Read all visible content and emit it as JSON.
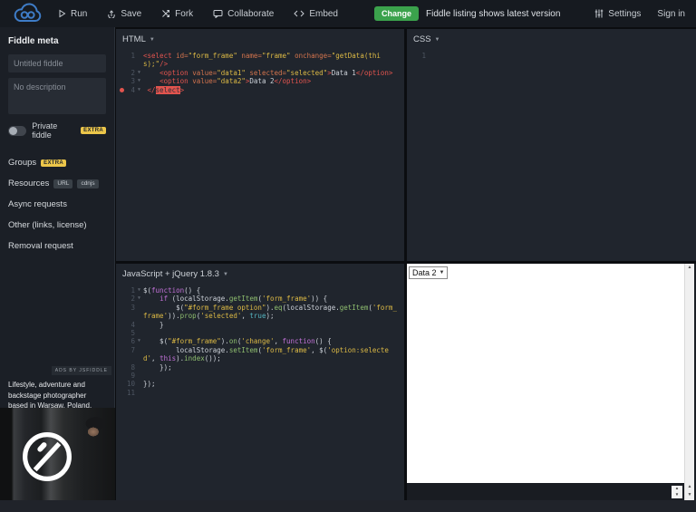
{
  "header": {
    "buttons": [
      {
        "label": "Run"
      },
      {
        "label": "Save"
      },
      {
        "label": "Fork"
      },
      {
        "label": "Collaborate"
      },
      {
        "label": "Embed"
      }
    ],
    "change_badge": "Change",
    "notice": "Fiddle listing shows latest version",
    "settings_label": "Settings",
    "sign_in_label": "Sign in"
  },
  "sidebar": {
    "meta_title": "Fiddle meta",
    "title_placeholder": "Untitled fiddle",
    "description_placeholder": "No description",
    "private_label": "Private fiddle",
    "private_badge": "EXTRA",
    "items": [
      {
        "label": "Groups",
        "badges": [
          "EXTRA"
        ]
      },
      {
        "label": "Resources",
        "badges": [
          "URL",
          "cdnjs"
        ]
      },
      {
        "label": "Async requests",
        "badges": []
      },
      {
        "label": "Other (links, license)",
        "badges": []
      },
      {
        "label": "Removal request",
        "badges": []
      }
    ],
    "ad": {
      "label": "ADS BY JSFIDDLE",
      "text": "Lifestyle, adventure and backstage photographer based in Warsaw, Poland."
    }
  },
  "editors": {
    "html": {
      "title": "HTML",
      "lines": [
        {
          "n": 1,
          "seg": [
            {
              "t": "<select",
              "c": "tag"
            },
            {
              "t": " ",
              "c": "plain"
            },
            {
              "t": "id=",
              "c": "attr"
            },
            {
              "t": "\"form_frame\"",
              "c": "val"
            },
            {
              "t": " ",
              "c": "plain"
            },
            {
              "t": "name=",
              "c": "attr"
            },
            {
              "t": "\"frame\"",
              "c": "val"
            },
            {
              "t": " ",
              "c": "plain"
            },
            {
              "t": "onchange=",
              "c": "attr"
            },
            {
              "t": "\"getData(thi",
              "c": "val"
            },
            {
              "br": true
            },
            {
              "t": "s);\"",
              "c": "val"
            },
            {
              "t": "/>",
              "c": "tag"
            }
          ]
        },
        {
          "n": 2,
          "fold": true,
          "seg": [
            {
              "t": "    ",
              "c": "plain"
            },
            {
              "t": "<option",
              "c": "tag"
            },
            {
              "t": " ",
              "c": "plain"
            },
            {
              "t": "value=",
              "c": "attr"
            },
            {
              "t": "\"data1\"",
              "c": "val"
            },
            {
              "t": " ",
              "c": "plain"
            },
            {
              "t": "selected=",
              "c": "attr"
            },
            {
              "t": "\"selected\"",
              "c": "val"
            },
            {
              "t": ">",
              "c": "tag"
            },
            {
              "t": "Data 1",
              "c": "plain"
            },
            {
              "t": "</option>",
              "c": "tag"
            }
          ]
        },
        {
          "n": 3,
          "fold": true,
          "seg": [
            {
              "t": "    ",
              "c": "plain"
            },
            {
              "t": "<option",
              "c": "tag"
            },
            {
              "t": " ",
              "c": "plain"
            },
            {
              "t": "value=",
              "c": "attr"
            },
            {
              "t": "\"data2\"",
              "c": "val"
            },
            {
              "t": ">",
              "c": "tag"
            },
            {
              "t": "Data 2",
              "c": "plain"
            },
            {
              "t": "</option>",
              "c": "tag"
            }
          ]
        },
        {
          "n": 4,
          "fold": true,
          "error": true,
          "seg": [
            {
              "t": " ",
              "c": "plain"
            },
            {
              "t": "</",
              "c": "tag"
            },
            {
              "t": "select",
              "c": "errhl"
            },
            {
              "t": ">",
              "c": "tag"
            }
          ]
        }
      ]
    },
    "css": {
      "title": "CSS",
      "lines": [
        {
          "n": 1,
          "seg": []
        }
      ]
    },
    "js": {
      "title": "JavaScript + jQuery 1.8.3",
      "lines": [
        {
          "n": 1,
          "fold": true,
          "seg": [
            {
              "t": "$(",
              "c": "plain"
            },
            {
              "t": "function",
              "c": "kw"
            },
            {
              "t": "() {",
              "c": "plain"
            }
          ]
        },
        {
          "n": 2,
          "fold": true,
          "seg": [
            {
              "t": "    ",
              "c": "plain"
            },
            {
              "t": "if",
              "c": "kw"
            },
            {
              "t": " (localStorage.",
              "c": "plain"
            },
            {
              "t": "getItem",
              "c": "fn"
            },
            {
              "t": "(",
              "c": "plain"
            },
            {
              "t": "'form_frame'",
              "c": "str"
            },
            {
              "t": ")) {",
              "c": "plain"
            }
          ]
        },
        {
          "n": 3,
          "seg": [
            {
              "t": "        $(",
              "c": "plain"
            },
            {
              "t": "\"#form_frame option\"",
              "c": "str"
            },
            {
              "t": ").",
              "c": "plain"
            },
            {
              "t": "eq",
              "c": "fn"
            },
            {
              "t": "(localStorage.",
              "c": "plain"
            },
            {
              "t": "getItem",
              "c": "fn"
            },
            {
              "t": "(",
              "c": "plain"
            },
            {
              "t": "'form_",
              "c": "str"
            },
            {
              "br": true
            },
            {
              "t": "frame'",
              "c": "str"
            },
            {
              "t": ")).",
              "c": "plain"
            },
            {
              "t": "prop",
              "c": "fn"
            },
            {
              "t": "(",
              "c": "plain"
            },
            {
              "t": "'selected'",
              "c": "str"
            },
            {
              "t": ", ",
              "c": "plain"
            },
            {
              "t": "true",
              "c": "bool"
            },
            {
              "t": ");",
              "c": "plain"
            }
          ]
        },
        {
          "n": 4,
          "seg": [
            {
              "t": "    }",
              "c": "plain"
            }
          ]
        },
        {
          "n": 5,
          "seg": []
        },
        {
          "n": 6,
          "fold": true,
          "seg": [
            {
              "t": "    $(",
              "c": "plain"
            },
            {
              "t": "\"#form_frame\"",
              "c": "str"
            },
            {
              "t": ").",
              "c": "plain"
            },
            {
              "t": "on",
              "c": "fn"
            },
            {
              "t": "(",
              "c": "plain"
            },
            {
              "t": "'change'",
              "c": "str"
            },
            {
              "t": ", ",
              "c": "plain"
            },
            {
              "t": "function",
              "c": "kw"
            },
            {
              "t": "() {",
              "c": "plain"
            }
          ]
        },
        {
          "n": 7,
          "seg": [
            {
              "t": "        localStorage.",
              "c": "plain"
            },
            {
              "t": "setItem",
              "c": "fn"
            },
            {
              "t": "(",
              "c": "plain"
            },
            {
              "t": "'form_frame'",
              "c": "str"
            },
            {
              "t": ", $(",
              "c": "plain"
            },
            {
              "t": "'option:selecte",
              "c": "str"
            },
            {
              "br": true
            },
            {
              "t": "d'",
              "c": "str"
            },
            {
              "t": ", ",
              "c": "plain"
            },
            {
              "t": "this",
              "c": "kw"
            },
            {
              "t": ").",
              "c": "plain"
            },
            {
              "t": "index",
              "c": "fn"
            },
            {
              "t": "());",
              "c": "plain"
            }
          ]
        },
        {
          "n": 8,
          "seg": [
            {
              "t": "    });",
              "c": "plain"
            }
          ]
        },
        {
          "n": 9,
          "seg": []
        },
        {
          "n": 10,
          "seg": [
            {
              "t": "});",
              "c": "plain"
            }
          ]
        },
        {
          "n": 11,
          "seg": []
        }
      ]
    }
  },
  "result": {
    "select_value": "Data 2"
  }
}
